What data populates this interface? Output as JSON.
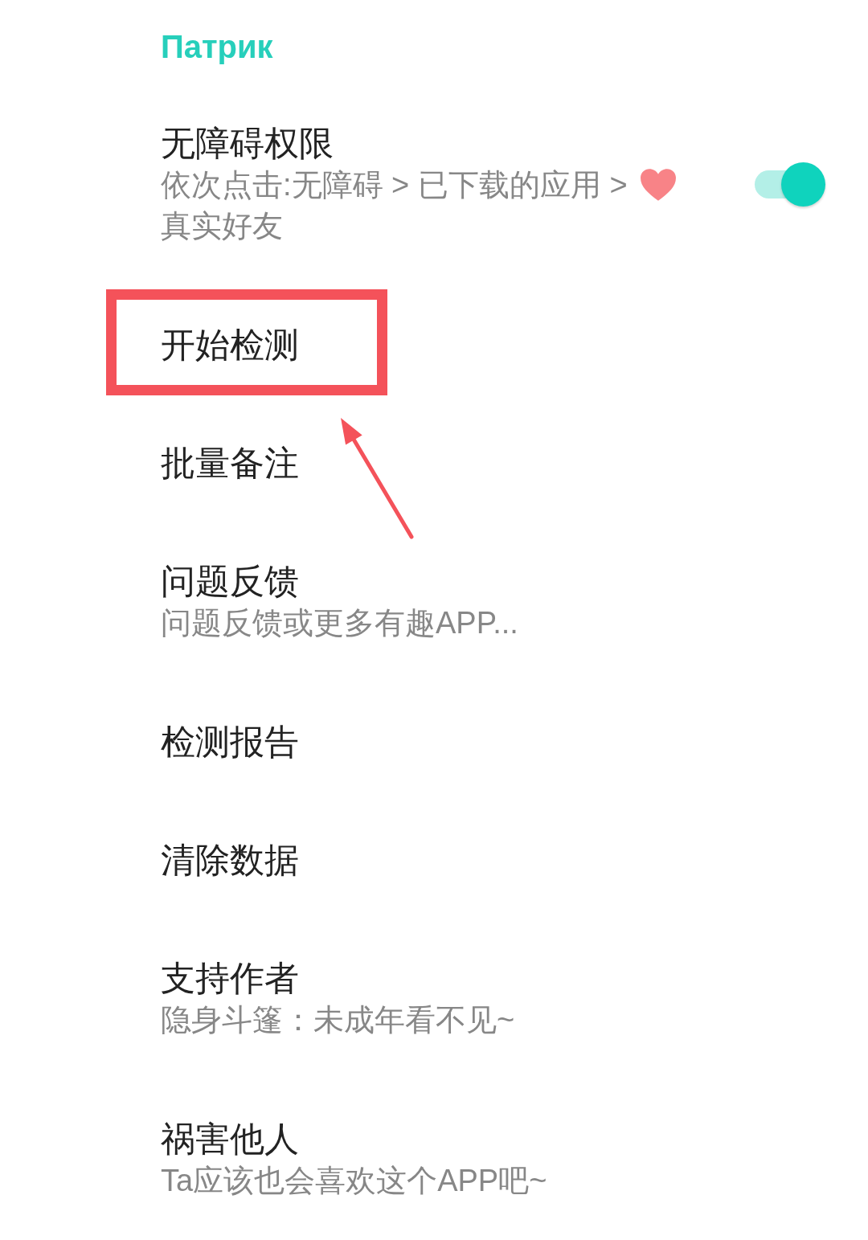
{
  "section": {
    "title": "Патрик"
  },
  "items": [
    {
      "kind": "toggle",
      "title": "无障碍权限",
      "subtitle_lines": [
        {
          "text": "依次点击:无障碍 > 已下载的应用 >",
          "trailing_icon": true
        },
        {
          "text": "真实好友",
          "trailing_icon": false
        }
      ],
      "on": true,
      "highlighted": false
    },
    {
      "kind": "plain",
      "title": "开始检测",
      "highlighted": true
    },
    {
      "kind": "plain",
      "title": "批量备注",
      "highlighted": false
    },
    {
      "kind": "plain",
      "title": "问题反馈",
      "subtitle_lines": [
        {
          "text": "问题反馈或更多有趣APP...",
          "trailing_icon": false
        }
      ],
      "highlighted": false
    },
    {
      "kind": "plain",
      "title": "检测报告",
      "highlighted": false
    },
    {
      "kind": "plain",
      "title": "清除数据",
      "highlighted": false
    },
    {
      "kind": "plain",
      "title": "支持作者",
      "subtitle_lines": [
        {
          "text": "隐身斗篷：未成年看不见~",
          "trailing_icon": false
        }
      ],
      "highlighted": false
    },
    {
      "kind": "plain",
      "title": "祸害他人",
      "subtitle_lines": [
        {
          "text": "Ta应该也会喜欢这个APP吧~",
          "trailing_icon": false
        }
      ],
      "highlighted": false
    }
  ]
}
